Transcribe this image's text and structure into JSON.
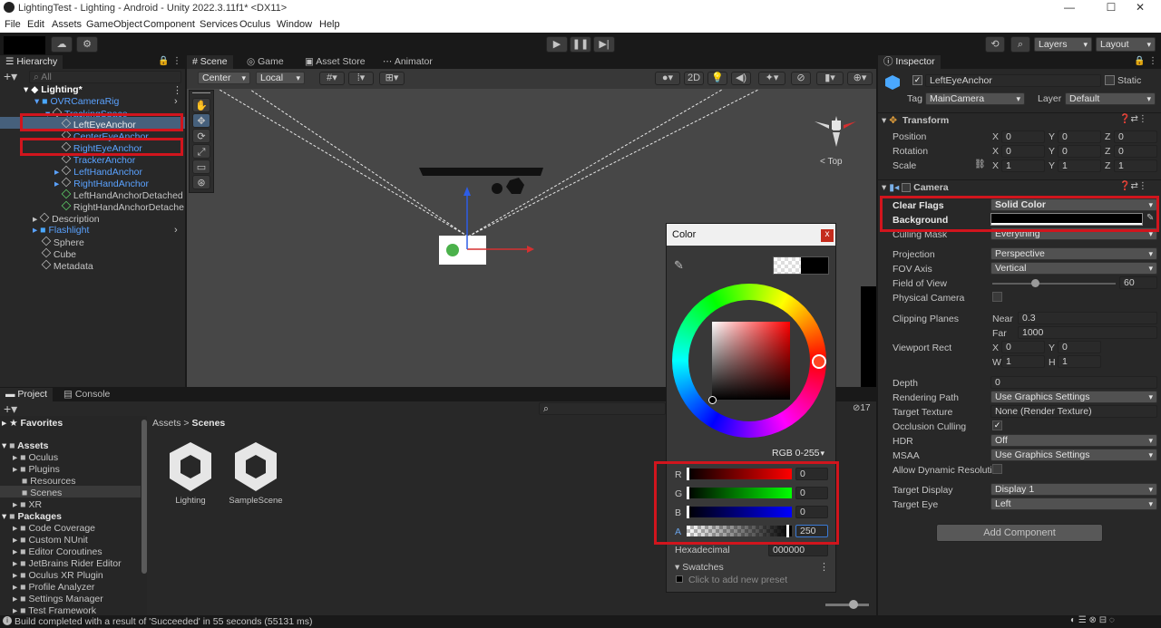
{
  "titlebar": {
    "title": "LightingTest - Lighting - Android - Unity 2022.3.11f1* <DX11>",
    "min": "—",
    "max": "☐",
    "close": "✕"
  },
  "menubar": {
    "items": [
      "File",
      "Edit",
      "Assets",
      "GameObject",
      "Component",
      "Services",
      "Oculus",
      "Window",
      "Help"
    ]
  },
  "toolbar": {
    "layers": "Layers",
    "layout": "Layout",
    "twoD": "2D"
  },
  "hierarchy": {
    "tab": "Hierarchy",
    "search_placeholder": "All",
    "items": [
      {
        "label": "Lighting*"
      },
      {
        "label": "OVRCameraRig"
      },
      {
        "label": "TrackingSpace"
      },
      {
        "label": "LeftEyeAnchor"
      },
      {
        "label": "CenterEyeAnchor"
      },
      {
        "label": "RightEyeAnchor"
      },
      {
        "label": "TrackerAnchor"
      },
      {
        "label": "LeftHandAnchor"
      },
      {
        "label": "RightHandAnchor"
      },
      {
        "label": "LeftHandAnchorDetached"
      },
      {
        "label": "RightHandAnchorDetache"
      },
      {
        "label": "Description"
      },
      {
        "label": "Flashlight"
      },
      {
        "label": "Sphere"
      },
      {
        "label": "Cube"
      },
      {
        "label": "Metadata"
      }
    ]
  },
  "scene": {
    "tabs": [
      "Scene",
      "Game",
      "Asset Store",
      "Animator"
    ],
    "pivot": "Center",
    "space": "Local",
    "gizmo_label": "< Top"
  },
  "project": {
    "tabs": [
      "Project",
      "Console"
    ],
    "breadcrumb": [
      "Assets",
      "Scenes"
    ],
    "count": "17",
    "tree": [
      {
        "label": "Favorites",
        "kind": "root"
      },
      {
        "label": "Assets",
        "kind": "root"
      },
      {
        "label": "Oculus",
        "kind": "folder"
      },
      {
        "label": "Plugins",
        "kind": "folder"
      },
      {
        "label": "Resources",
        "kind": "folder"
      },
      {
        "label": "Scenes",
        "kind": "folder"
      },
      {
        "label": "XR",
        "kind": "folder"
      },
      {
        "label": "Packages",
        "kind": "root"
      },
      {
        "label": "Code Coverage",
        "kind": "folder"
      },
      {
        "label": "Custom NUnit",
        "kind": "folder"
      },
      {
        "label": "Editor Coroutines",
        "kind": "folder"
      },
      {
        "label": "JetBrains Rider Editor",
        "kind": "folder"
      },
      {
        "label": "Oculus XR Plugin",
        "kind": "folder"
      },
      {
        "label": "Profile Analyzer",
        "kind": "folder"
      },
      {
        "label": "Settings Manager",
        "kind": "folder"
      },
      {
        "label": "Test Framework",
        "kind": "folder"
      }
    ],
    "assets": [
      "Lighting",
      "SampleScene"
    ]
  },
  "color_picker": {
    "title": "Color",
    "close": "x",
    "mode": "RGB 0-255",
    "r_label": "R",
    "r_value": "0",
    "g_label": "G",
    "g_value": "0",
    "b_label": "B",
    "b_value": "0",
    "a_label": "A",
    "a_value": "250",
    "hex_label": "Hexadecimal",
    "hex_value": "000000",
    "swatches": "Swatches",
    "swatches_hint": "Click to add new preset",
    "ring_color": "#ff3b3b"
  },
  "inspector": {
    "tab": "Inspector",
    "object_name": "LeftEyeAnchor",
    "static": "Static",
    "tag_label": "Tag",
    "tag_value": "MainCamera",
    "layer_label": "Layer",
    "layer_value": "Default",
    "transform": {
      "title": "Transform",
      "position": {
        "label": "Position",
        "x": "0",
        "y": "0",
        "z": "0"
      },
      "rotation": {
        "label": "Rotation",
        "x": "0",
        "y": "0",
        "z": "0"
      },
      "scale": {
        "label": "Scale",
        "x": "1",
        "y": "1",
        "z": "1"
      }
    },
    "camera": {
      "title": "Camera",
      "clear_flags_label": "Clear Flags",
      "clear_flags_value": "Solid Color",
      "background_label": "Background",
      "culling_label": "Culling Mask",
      "culling_value": "Everything",
      "projection_label": "Projection",
      "projection_value": "Perspective",
      "fov_axis_label": "FOV Axis",
      "fov_axis_value": "Vertical",
      "fov_label": "Field of View",
      "fov_value": "60",
      "physical_label": "Physical Camera",
      "clipping_label": "Clipping Planes",
      "near_label": "Near",
      "near_value": "0.3",
      "far_label": "Far",
      "far_value": "1000",
      "viewport_label": "Viewport Rect",
      "vx": "0",
      "vy": "0",
      "vw": "1",
      "vh": "1",
      "depth_label": "Depth",
      "depth_value": "0",
      "rendering_path_label": "Rendering Path",
      "rendering_path_value": "Use Graphics Settings",
      "target_texture_label": "Target Texture",
      "target_texture_value": "None (Render Texture)",
      "occlusion_label": "Occlusion Culling",
      "hdr_label": "HDR",
      "hdr_value": "Off",
      "msaa_label": "MSAA",
      "msaa_value": "Use Graphics Settings",
      "dynres_label": "Allow Dynamic Resoluti",
      "target_display_label": "Target Display",
      "target_display_value": "Display 1",
      "target_eye_label": "Target Eye",
      "target_eye_value": "Left"
    },
    "add_component": "Add Component"
  },
  "statusbar": {
    "message": "Build completed with a result of 'Succeeded' in 55 seconds (55131 ms)"
  }
}
